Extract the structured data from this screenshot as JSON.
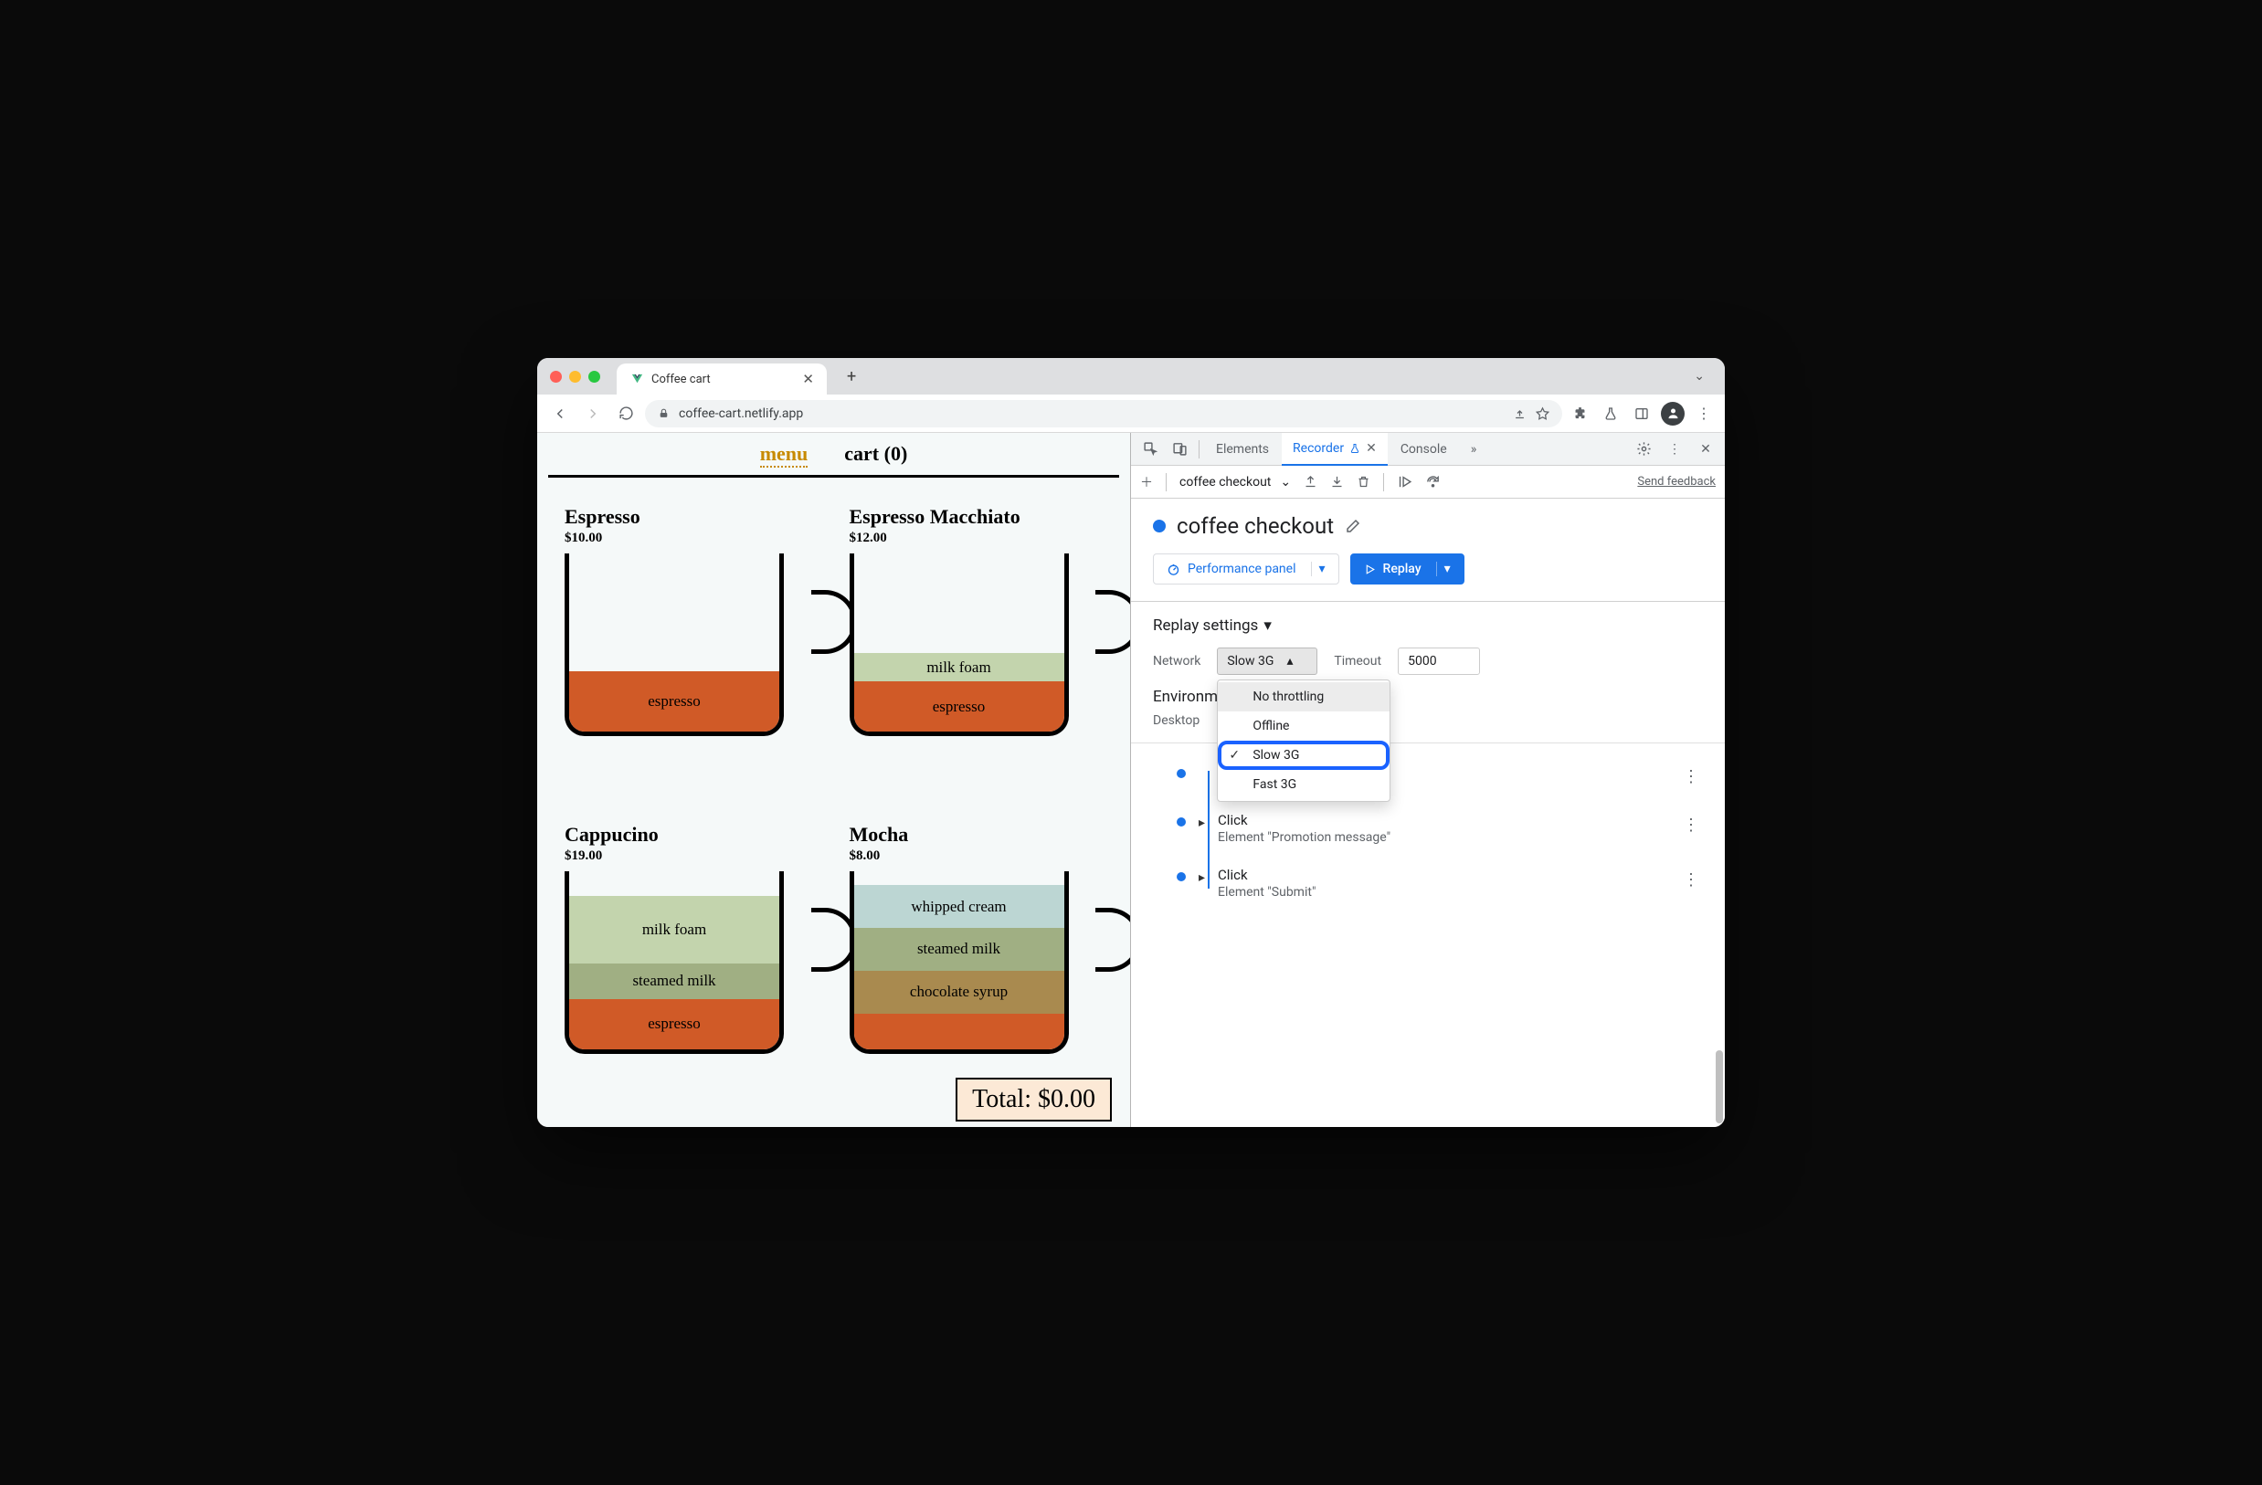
{
  "browser": {
    "tab_title": "Coffee cart",
    "url": "coffee-cart.netlify.app"
  },
  "page": {
    "nav": {
      "menu": "menu",
      "cart": "cart (0)"
    },
    "items": [
      {
        "name": "Espresso",
        "price": "$10.00"
      },
      {
        "name": "Espresso Macchiato",
        "price": "$12.00"
      },
      {
        "name": "Cappucino",
        "price": "$19.00"
      },
      {
        "name": "Mocha",
        "price": "$8.00"
      }
    ],
    "layers": {
      "espresso": "espresso",
      "milk_foam": "milk foam",
      "steamed_milk": "steamed milk",
      "whipped_cream": "whipped cream",
      "chocolate_syrup": "chocolate syrup"
    },
    "total": "Total: $0.00"
  },
  "devtools": {
    "tabs": {
      "elements": "Elements",
      "recorder": "Recorder",
      "console": "Console"
    },
    "toolbar": {
      "recording_name": "coffee checkout",
      "feedback": "Send feedback"
    },
    "title": "coffee checkout",
    "buttons": {
      "perf_panel": "Performance panel",
      "replay": "Replay"
    },
    "settings": {
      "title": "Replay settings",
      "network_label": "Network",
      "network_value": "Slow 3G",
      "network_options": [
        "No throttling",
        "Offline",
        "Slow 3G",
        "Fast 3G"
      ],
      "timeout_label": "Timeout",
      "timeout_value": "5000",
      "environment_label": "Environm",
      "environment_value": "Desktop"
    },
    "steps": [
      {
        "action": "Click",
        "detail": "Element \"Promotion message\""
      },
      {
        "action": "Click",
        "detail": "Element \"Submit\""
      }
    ]
  }
}
